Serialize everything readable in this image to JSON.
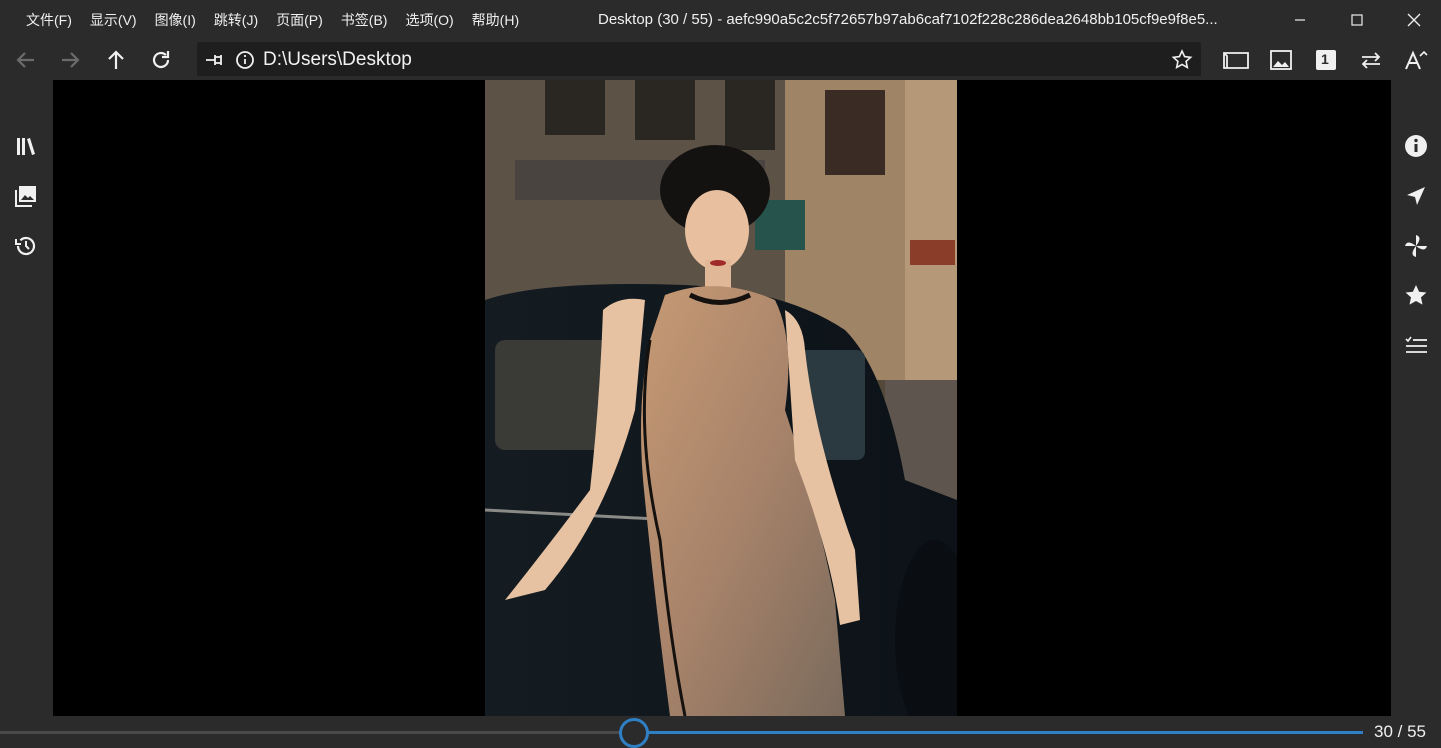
{
  "menu": {
    "items": [
      "文件(F)",
      "显示(V)",
      "图像(I)",
      "跳转(J)",
      "页面(P)",
      "书签(B)",
      "选项(O)",
      "帮助(H)"
    ]
  },
  "window": {
    "title": "Desktop (30 / 55) - aefc990a5c2c5f72657b97ab6caf7102f228c286dea2648bb105cf9e9f8e5..."
  },
  "address": {
    "path": "D:\\Users\\Desktop"
  },
  "toolbar": {
    "page_badge": "1"
  },
  "navigation": {
    "current": 30,
    "total": 55,
    "counter_text": "30 / 55",
    "progress_fraction": 0.545
  },
  "colors": {
    "accent": "#2f7fc4",
    "chrome": "#2b2b2b",
    "viewer_bg": "#000000"
  },
  "icons": {
    "left_sidebar": [
      "library-icon",
      "gallery-icon",
      "history-icon"
    ],
    "right_sidebar": [
      "info-icon",
      "navigate-icon",
      "pinwheel-icon",
      "star-icon",
      "checklist-icon"
    ]
  }
}
